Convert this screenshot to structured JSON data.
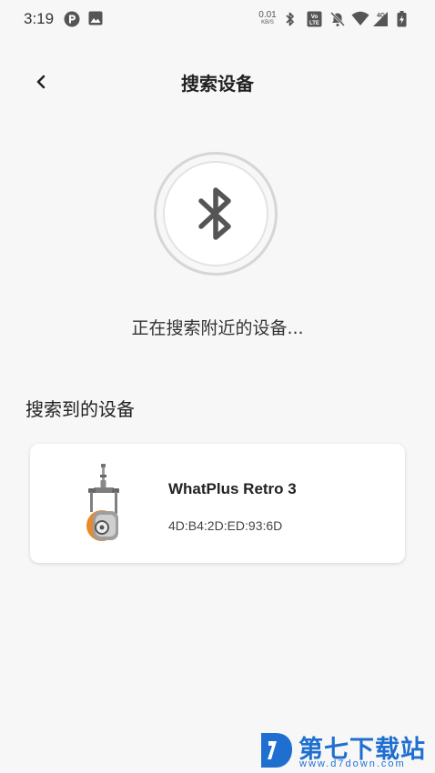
{
  "status_bar": {
    "time": "3:19",
    "net_speed_value": "0.01",
    "net_speed_unit": "KB/S",
    "network_type": "4G",
    "volte_label": "Vo LTE"
  },
  "header": {
    "title": "搜索设备"
  },
  "search": {
    "status_text": "正在搜索附近的设备..."
  },
  "found_section": {
    "title": "搜索到的设备"
  },
  "devices": [
    {
      "name": "WhatPlus Retro 3",
      "mac": "4D:B4:2D:ED:93:6D"
    }
  ],
  "watermark": {
    "text": "第七下载站",
    "url": "www.d7down.com"
  },
  "colors": {
    "background": "#f7f7f7",
    "card": "#ffffff",
    "watermark": "#1e6fd0",
    "icon": "#555555"
  }
}
